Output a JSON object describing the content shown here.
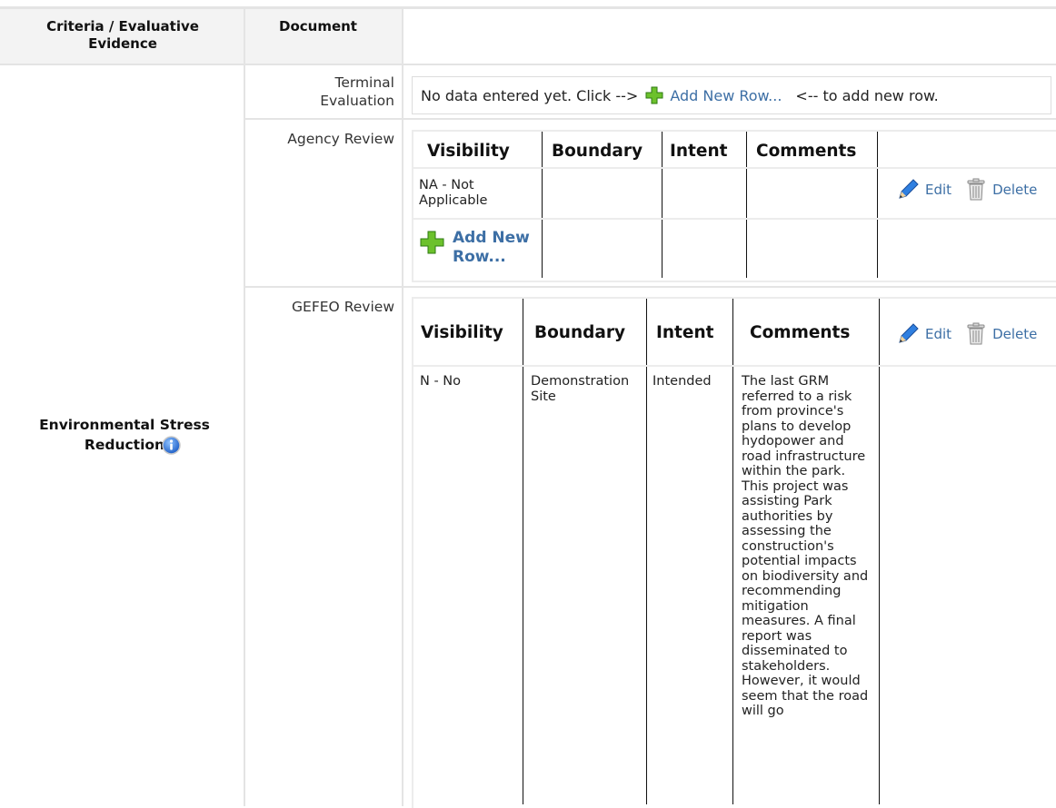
{
  "header": {
    "criteria_label": "Criteria / Evaluative Evidence",
    "document_label": "Document"
  },
  "criterion": {
    "label": "Environmental Stress Reduction",
    "info_icon": "info-circle-icon"
  },
  "terminal_evaluation": {
    "doc_label": "Terminal Evaluation",
    "no_data_prefix": "No data entered yet. Click -->",
    "add_link": "Add New Row...",
    "no_data_suffix": "<-- to add new row."
  },
  "agency_review": {
    "doc_label": "Agency Review",
    "columns": [
      "Visibility",
      "Boundary",
      "Intent",
      "Comments"
    ],
    "rows": [
      {
        "visibility": "NA - Not Applicable",
        "boundary": "",
        "intent": "",
        "comments": ""
      }
    ],
    "edit_label": "Edit",
    "delete_label": "Delete",
    "add_link": "Add New Row..."
  },
  "gefeo_review": {
    "doc_label": "GEFEO Review",
    "columns": [
      "Visibility",
      "Boundary",
      "Intent",
      "Comments"
    ],
    "rows": [
      {
        "visibility": "N - No",
        "boundary": "Demonstration Site",
        "intent": "Intended",
        "comments": "The last GRM referred to a risk from province's plans to develop hydopower and road infrastructure within the park. This project was assisting Park authorities by assessing the construction's potential impacts on biodiversity and recommending mitigation measures. A final report was disseminated to stakeholders. However, it would seem that the road will go"
      }
    ],
    "edit_label": "Edit",
    "delete_label": "Delete"
  },
  "icons": {
    "add": "plus-green-icon",
    "edit": "pencil-icon",
    "delete": "trash-icon",
    "info": "info-circle-icon"
  },
  "colors": {
    "link": "#3d6fa5",
    "header_bg": "#f3f3f3",
    "grid_line": "#e4e4e4",
    "add_green": "#6cc12c"
  }
}
